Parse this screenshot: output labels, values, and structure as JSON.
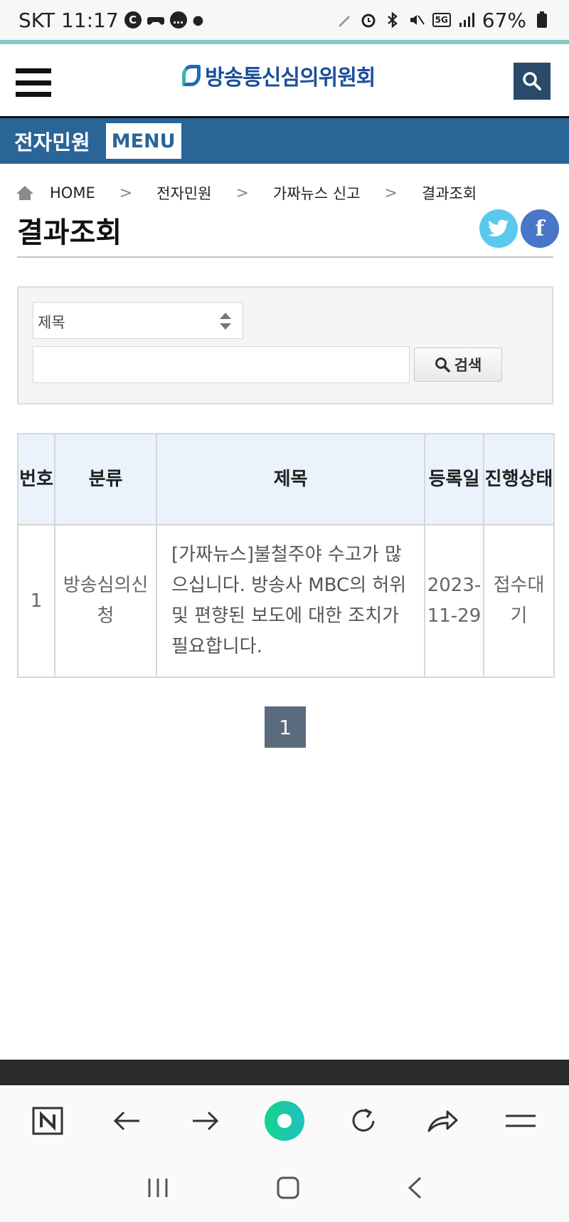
{
  "status_bar": {
    "carrier_time": "SKT 11:17",
    "network": "5G",
    "battery": "67%"
  },
  "header": {
    "logo_text": "방송통신심의위원회"
  },
  "section_bar": {
    "title": "전자민원",
    "menu_label": "MENU"
  },
  "breadcrumb": {
    "items": [
      "HOME",
      "전자민원",
      "가짜뉴스 신고",
      "결과조회"
    ]
  },
  "page_title": "결과조회",
  "search": {
    "select_value": "제목",
    "input_value": "",
    "button_label": "검색"
  },
  "table": {
    "headers": [
      "번호",
      "분류",
      "제목",
      "등록일",
      "진행상태"
    ],
    "rows": [
      {
        "no": "1",
        "category": "방송심의신청",
        "title": "[가짜뉴스]불철주야 수고가 많으십니다. 방송사 MBC의 허위 및 편향된 보도에 대한 조치가 필요합니다.",
        "date": "2023-11-29",
        "status": "접수대기"
      }
    ]
  },
  "pagination": {
    "current": "1"
  },
  "colors": {
    "brand_blue": "#2a6598",
    "header_bg": "#eaf3fb",
    "page_active": "#5a6b7d"
  }
}
